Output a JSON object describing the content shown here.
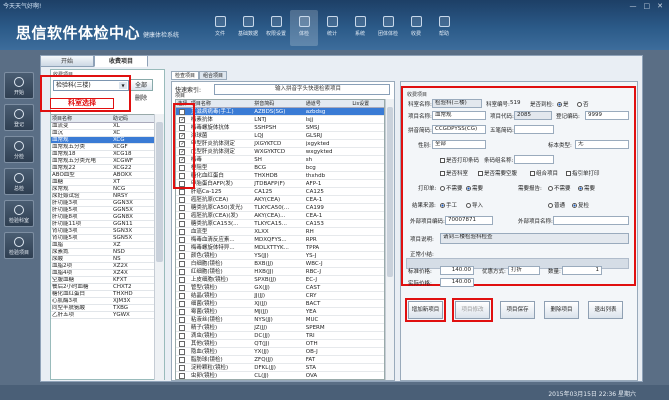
{
  "header": {
    "greeting": "今天天气好啊!",
    "title": "思信软件体检中心",
    "subtitle": "健康体检系统",
    "window_buttons": [
      "—",
      "□",
      "✕"
    ],
    "toolbar": [
      {
        "label": "文件",
        "icon": "file-icon"
      },
      {
        "label": "基础数据",
        "icon": "database-icon"
      },
      {
        "label": "权限设置",
        "icon": "lock-icon"
      },
      {
        "label": "体检",
        "icon": "health-icon",
        "active": true
      },
      {
        "label": "统计",
        "icon": "chart-icon"
      },
      {
        "label": "系统",
        "icon": "gear-icon"
      },
      {
        "label": "团体体检",
        "icon": "group-icon"
      },
      {
        "label": "收费",
        "icon": "money-icon"
      },
      {
        "label": "帮助",
        "icon": "help-icon"
      }
    ]
  },
  "leftnav": [
    {
      "label": "开始",
      "icon": "home-icon"
    },
    {
      "label": "登记",
      "icon": "register-icon"
    },
    {
      "label": "分检",
      "icon": "split-icon"
    },
    {
      "label": "总检",
      "icon": "check-icon"
    },
    {
      "label": "检验科室",
      "icon": "lab-icon"
    },
    {
      "label": "检验项目",
      "icon": "items-icon"
    }
  ],
  "tabs": [
    "开始",
    "收费项目"
  ],
  "left_panel": {
    "label": "收费项目",
    "dept_select": "检验科(三楼)",
    "all_button": "全部",
    "remove_label": "删除",
    "annotation": "科室选择",
    "headers": [
      "项目名称",
      "助记码"
    ],
    "rows": [
      [
        "血流变",
        "XL"
      ],
      [
        "血沉",
        "XC"
      ],
      [
        "血常规",
        "XCG"
      ],
      [
        "血常规五分类",
        "XCGF"
      ],
      [
        "血常规18",
        "XCG18"
      ],
      [
        "血常规五分类光电",
        "XCGWF"
      ],
      [
        "血常规22",
        "XCG22"
      ],
      [
        "ABO血型",
        "ABOXX"
      ],
      [
        "血糖",
        "XT"
      ],
      [
        "尿常规",
        "NCG"
      ],
      [
        "尿妊娠试验",
        "NRSY"
      ],
      [
        "肝功能3项",
        "GGN3X"
      ],
      [
        "肝功能5项",
        "GGN5X"
      ],
      [
        "肝功能8项",
        "GGN8X"
      ],
      [
        "肝功能11项",
        "GGN11"
      ],
      [
        "肾功能3项",
        "SGN3X"
      ],
      [
        "肾功能5项",
        "SGN5X"
      ],
      [
        "血脂",
        "XZ"
      ],
      [
        "尿素氮",
        "NSD"
      ],
      [
        "尿酸",
        "NS"
      ],
      [
        "血脂2项",
        "XZ2X"
      ],
      [
        "血脂4项",
        "XZ4X"
      ],
      [
        "空腹血糖",
        "KFXT"
      ],
      [
        "餐后2小时血糖",
        "CHXT2"
      ],
      [
        "糖化血红蛋白",
        "THXHD"
      ],
      [
        "心肌酶3项",
        "XJM3X"
      ],
      [
        "同型半胱氨酸",
        "TXBG"
      ],
      [
        "乙肝五项",
        "YGWX"
      ]
    ]
  },
  "middle_panel": {
    "tabs": [
      "检查项目",
      "组合项目"
    ],
    "search_label": "快速索引:",
    "search_placeholder": "输入拼音字头快速检索项目",
    "grid_label": "项目",
    "headers": [
      "选择",
      "项目名称",
      "拼音简码",
      "通道号",
      "Lis设置"
    ],
    "rows": [
      {
        "checked": false,
        "name": "艾滋病病毒(手工)",
        "py": "AZBDS(SG)",
        "ch": "azbdsg",
        "sel": true
      },
      {
        "checked": true,
        "name": "梅素抗体",
        "py": "LNTJ",
        "ch": "lsjj"
      },
      {
        "checked": false,
        "name": "梅毒螺旋体抗体",
        "py": "SSHPSH",
        "ch": "SMSJ"
      },
      {
        "checked": true,
        "name": "淋球菌",
        "py": "LQJ",
        "ch": "GLSRJ"
      },
      {
        "checked": true,
        "name": "甲型肝炎抗体测定",
        "py": "JXGYKTCD",
        "ch": "jxgykted"
      },
      {
        "checked": true,
        "name": "戊型肝炎抗体测定",
        "py": "WXGYKTCD",
        "ch": "wxgykted"
      },
      {
        "checked": true,
        "name": "梅毒",
        "py": "SH",
        "ch": "sh"
      },
      {
        "checked": false,
        "name": "梗阻型",
        "py": "BCG",
        "ch": "bcg"
      },
      {
        "checked": false,
        "name": "糖化血红蛋白",
        "py": "THXHDB",
        "ch": "thxhdb"
      },
      {
        "checked": false,
        "name": "甲胎蛋白AFP(发)",
        "py": "JTDBAFP(F)",
        "ch": "AFP-1"
      },
      {
        "checked": false,
        "name": "肝癌Ca-125",
        "py": "CA125",
        "ch": "CA125"
      },
      {
        "checked": false,
        "name": "癌胚抗原(CEA)",
        "py": "AKY(CEA)",
        "ch": "CEA-1"
      },
      {
        "checked": false,
        "name": "糖类抗原CA50(发光)",
        "py": "TLKYCA50(...",
        "ch": "CA199"
      },
      {
        "checked": false,
        "name": "癌胚抗原(CEA)(发)",
        "py": "AKY(CEA)...",
        "ch": "CEA-1"
      },
      {
        "checked": false,
        "name": "糖类抗原CA153(...",
        "py": "TLKYCA15...",
        "ch": "CA153"
      },
      {
        "checked": false,
        "name": "血流型",
        "py": "XLXX",
        "ch": "RH"
      },
      {
        "checked": false,
        "name": "梅毒血清反应素...",
        "py": "MDXQFYS...",
        "ch": "RPR"
      },
      {
        "checked": false,
        "name": "梅毒螺旋体特异...",
        "py": "MDLXTTYK...",
        "ch": "TPPA"
      },
      {
        "checked": false,
        "name": "颜色(镜检)",
        "py": "YS(JJ)",
        "ch": "YS-J"
      },
      {
        "checked": false,
        "name": "白细胞(镜检)",
        "py": "BXB(JJ)",
        "ch": "WBC-J"
      },
      {
        "checked": false,
        "name": "红细胞(镜检)",
        "py": "HXB(JJ)",
        "ch": "RBC-J"
      },
      {
        "checked": false,
        "name": "上皮细胞(镜检)",
        "py": "SPXB(JJ)",
        "ch": "EC-J"
      },
      {
        "checked": false,
        "name": "管型(镜检)",
        "py": "GX(JJ)",
        "ch": "CAST"
      },
      {
        "checked": false,
        "name": "结晶(镜检)",
        "py": "JJ(JJ)",
        "ch": "CRY"
      },
      {
        "checked": false,
        "name": "细菌(镜检)",
        "py": "XJ(JJ)",
        "ch": "BACT"
      },
      {
        "checked": false,
        "name": "霉菌(镜检)",
        "py": "MJ(JJ)",
        "ch": "YEA"
      },
      {
        "checked": false,
        "name": "粘液丝(镜检)",
        "py": "NYS(JJ)",
        "ch": "MUC"
      },
      {
        "checked": false,
        "name": "精子(镜检)",
        "py": "JZ(JJ)",
        "ch": "SPERM"
      },
      {
        "checked": false,
        "name": "滴虫(镜检)",
        "py": "DC(JJ)",
        "ch": "TRI"
      },
      {
        "checked": false,
        "name": "其他(镜检)",
        "py": "QT(JJ)",
        "ch": "OTH"
      },
      {
        "checked": false,
        "name": "隐血(镜检)",
        "py": "YX(JJ)",
        "ch": "OB-J"
      },
      {
        "checked": false,
        "name": "脂肪球(镜检)",
        "py": "ZFQ(JJ)",
        "ch": "FAT"
      },
      {
        "checked": false,
        "name": "淀粉颗粒(镜检)",
        "py": "DFKL(JJ)",
        "ch": "STA"
      },
      {
        "checked": false,
        "name": "虫卵(镜检)",
        "py": "CL(JJ)",
        "ch": "OVA"
      }
    ]
  },
  "right_panel": {
    "section": "收费项目",
    "dept_label": "科室名称:",
    "dept_value": "检验科(三楼)",
    "code_label": "科室编号:",
    "code_value": "519",
    "enable_label": "是否到检:",
    "yes": "是",
    "no": "否",
    "item_name_label": "项目名称:",
    "item_name_value": "血常规",
    "item_code_label": "项目代码:",
    "item_code_value": "2085",
    "reg_code_label": "登记编码:",
    "reg_code_value": "9999",
    "py_label": "拼音简码:",
    "py_value": "CCGDPYSS(CG)",
    "wb_label": "五笔简码:",
    "wb_value": "",
    "gender_label": "性别:",
    "gender_value": "全部",
    "specimen_label": "标本类型:",
    "specimen_value": "无",
    "cb_print": "是否打印条码",
    "barcode_label": "条码组名称:",
    "cb_dept": "是否科室",
    "cb_fasting": "是否需要空腹",
    "cb_combo": "组合项目",
    "cb_guide": "指引单打印",
    "print_label": "打印单:",
    "print_no": "不需要",
    "print_yes": "需要",
    "report_label": "需要报告:",
    "report_no": "不需要",
    "report_yes": "需要",
    "result_label": "结果来源:",
    "result_manual": "手工",
    "result_import": "导入",
    "normal_label": "普通",
    "checked_label": "复检",
    "ext_code_label": "外部项目编码:",
    "ext_code_value": "70007871",
    "ext_name_label": "外部项目名称:",
    "ext_name_value": "",
    "desc_label": "项目说明:",
    "desc_value": "请到三楼检验科检查",
    "note_label": "正常小结:",
    "note_value": "",
    "price_label": "标准价格:",
    "price_value": "140.00",
    "discount_label": "优惠方式:",
    "discount_value": "打折",
    "qty_label": "数量:",
    "qty_value": "1",
    "real_label": "实际价格:",
    "real_value": "140.00",
    "buttons": [
      "增加新项目",
      "项目修改",
      "项目保存",
      "删除项目",
      "退出列表"
    ]
  },
  "status": {
    "datetime": "2015年03月15日 22:36 星期六"
  }
}
